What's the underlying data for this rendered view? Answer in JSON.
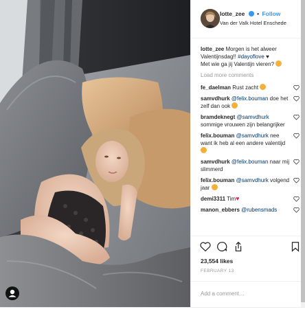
{
  "post": {
    "author": {
      "username": "lotte_zee",
      "follow_label": "Follow",
      "location": "Van der Valk Hotel Enschede",
      "verified": true,
      "avatar_icon": "profile-avatar"
    },
    "photo": {
      "icon": "photo-bed-pillows",
      "user_tag_icon": "user-tag-icon"
    },
    "caption": {
      "username": "lotte_zee",
      "text_start": "Morgen is het alweer Valentijnsdag!!",
      "hashtag": "#dayoflove",
      "text_heart": "♥",
      "text_end": "Met wie ga jij Valentijn vieren?",
      "emoji": "smiley-icon"
    },
    "load_more_label": "Load more comments",
    "comments": [
      {
        "username": "fe_daelman",
        "mention": "",
        "text": "Rust zacht",
        "emoji": "laugh-icon"
      },
      {
        "username": "samvdhurk",
        "mention": "@felix.bouman",
        "text": "doe het zelf dan ook",
        "emoji": "laugh-icon"
      },
      {
        "username": "bramdeknegt",
        "mention": "@samvdhurk",
        "text": "sommige vrouwen zijn belangrijker",
        "emoji": ""
      },
      {
        "username": "felix.bouman",
        "mention": "@samvdhurk",
        "text": "nee want ik heb al een andere valentijd",
        "emoji": "smiley-icon"
      },
      {
        "username": "samvdhurk",
        "mention": "@felix.bouman",
        "text": "naar mij slimmerd",
        "emoji": ""
      },
      {
        "username": "felix.bouman",
        "mention": "@samvdhurk",
        "text": "volgend jaar",
        "emoji": "laugh-icon"
      },
      {
        "username": "demi3311",
        "mention": "",
        "text": "Tim",
        "emoji": "red-heart-icon"
      },
      {
        "username": "manon_ebbers",
        "mention": "@rubensmads",
        "text": "",
        "emoji": ""
      }
    ],
    "actions": {
      "like_icon": "heart-outline-icon",
      "comment_icon": "speech-bubble-icon",
      "share_icon": "share-icon",
      "save_icon": "bookmark-icon"
    },
    "likes": "23,554 likes",
    "date": "FEBRUARY 13",
    "add_comment_placeholder": "Add a comment…",
    "colors": {
      "link_blue": "#3897f0",
      "mention_blue": "#003569",
      "muted_gray": "#999999",
      "border": "#efefef",
      "heart_red": "#e0245e"
    }
  }
}
